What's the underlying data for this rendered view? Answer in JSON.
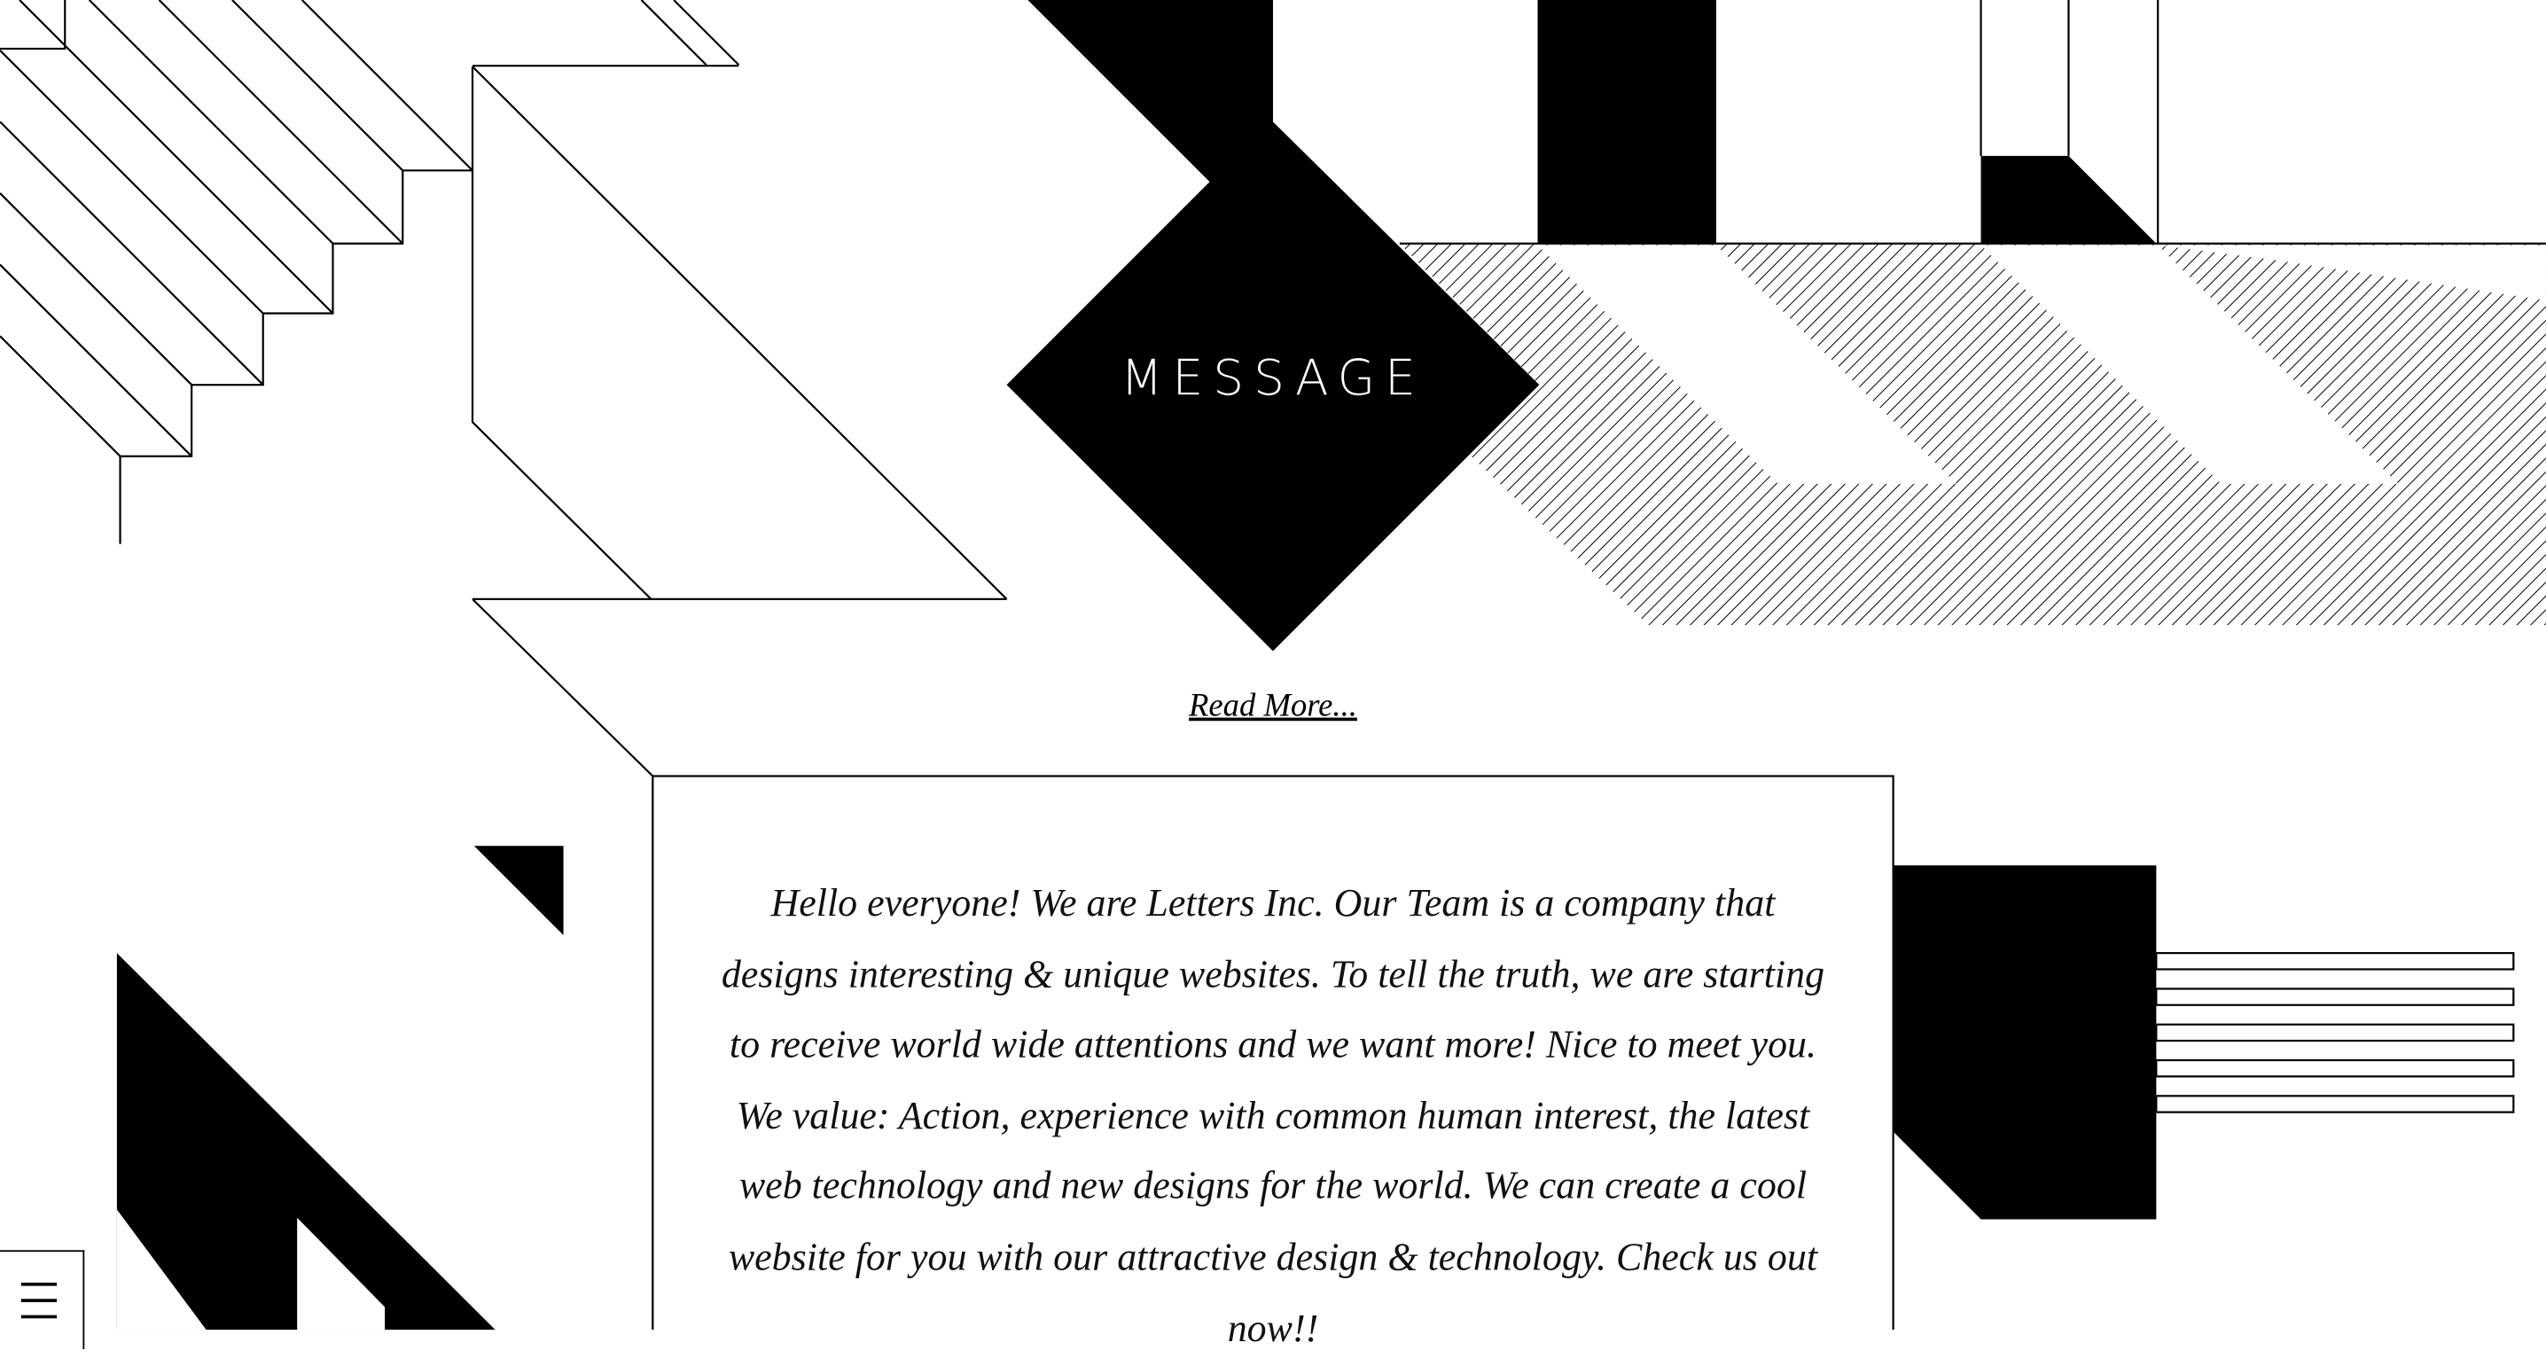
{
  "hero": {
    "title": "MESSAGE"
  },
  "read_more": {
    "label": "Read More..."
  },
  "message": {
    "text": "Hello everyone! We are Letters Inc. Our Team is a company that designs interesting & unique websites. To tell the truth, we are starting to receive world wide attentions and we want more! Nice to meet you. We value: Action, experience with common human interest, the latest web technology and new designs for the world. We can create a cool website for you with our attractive design & technology. Check us out now!!"
  },
  "menu": {
    "icon": "hamburger-menu-icon"
  },
  "colors": {
    "ink": "#000000",
    "paper": "#ffffff"
  }
}
